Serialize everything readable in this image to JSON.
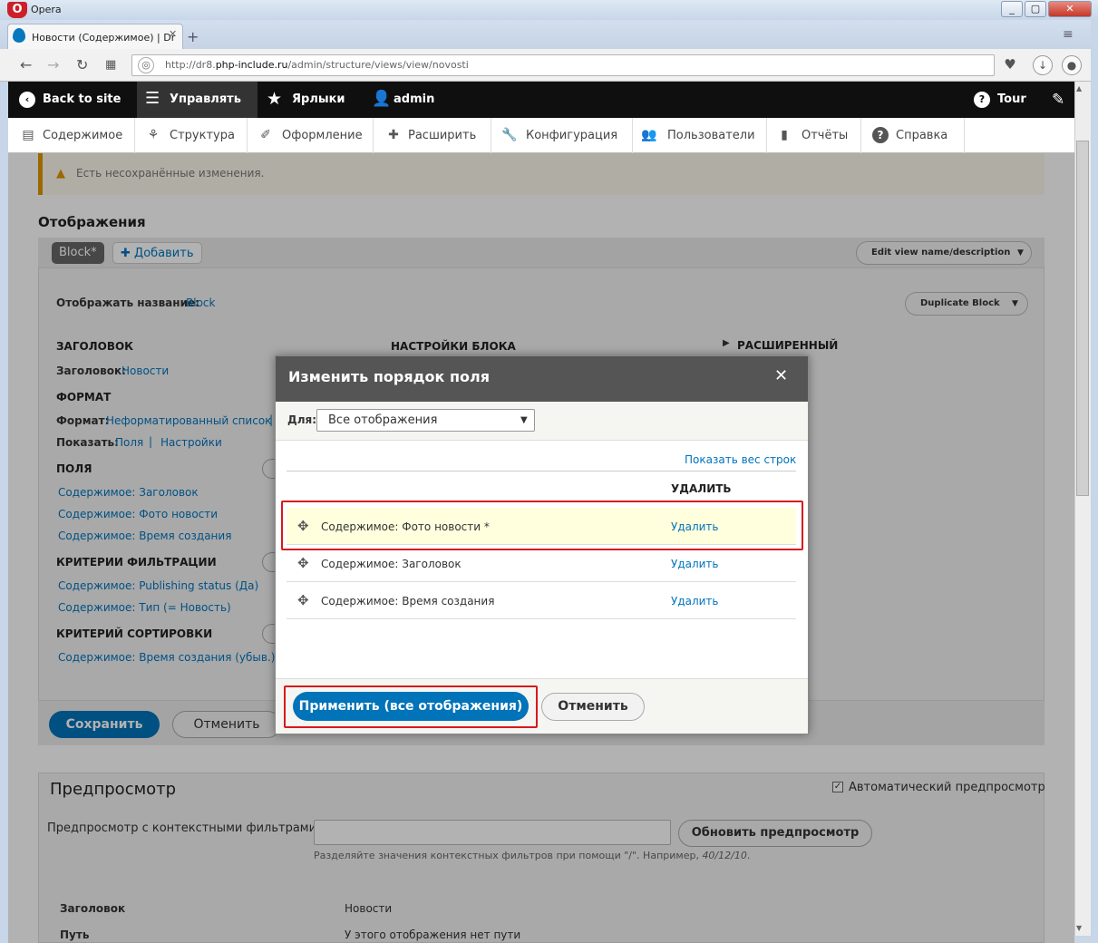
{
  "browser": {
    "app_name": "Opera",
    "tab_title": "Новости (Содержимое) | Dr",
    "url_prefix": "http://dr8.",
    "url_host": "php-include.ru",
    "url_path": "/admin/structure/views/view/novosti"
  },
  "toolbar": {
    "back": "Back to site",
    "manage": "Управлять",
    "shortcuts": "Ярлыки",
    "user": "admin",
    "tour": "Tour"
  },
  "tray": {
    "items": [
      "Содержимое",
      "Структура",
      "Оформление",
      "Расширить",
      "Конфигурация",
      "Пользователи",
      "Отчёты",
      "Справка"
    ]
  },
  "page": {
    "warning": "Есть несохранённые изменения.",
    "displays_title": "Отображения",
    "block_tab": "Block*",
    "add_tab": "Добавить",
    "edit_name_btn": "Edit view name/description",
    "duplicate_btn": "Duplicate Block",
    "display_name_label": "Отображать название:",
    "display_name_value": "Block",
    "col_title": "ЗАГОЛОВОК",
    "col_block_settings": "НАСТРОЙКИ БЛОКА",
    "col_advanced": "РАСШИРЕННЫЙ",
    "title_label": "Заголовок:",
    "title_value": "Новости",
    "format_h": "ФОРМАТ",
    "format_label": "Формат:",
    "format_value": "Неформатированный список",
    "show_label": "Показать:",
    "show_fields": "Поля",
    "show_settings": "Настройки",
    "fields_h": "ПОЛЯ",
    "fields": [
      "Содержимое: Заголовок",
      "Содержимое: Фото новости",
      "Содержимое: Время создания"
    ],
    "filters_h": "КРИТЕРИИ ФИЛЬТРАЦИИ",
    "filters": [
      "Содержимое: Publishing status (Да)",
      "Содержимое: Тип (= Новость)"
    ],
    "sort_h": "КРИТЕРИЙ СОРТИРОВКИ",
    "sorts": [
      "Содержимое: Время создания (убыв.)"
    ],
    "save_btn": "Сохранить",
    "cancel_btn": "Отменить",
    "preview_title": "Предпросмотр",
    "auto_preview": "Автоматический предпросмотр",
    "context_label": "Предпросмотр с контекстными фильтрами:",
    "update_preview_btn": "Обновить предпросмотр",
    "context_help": "Разделяйте значения контекстных фильтров при помощи \"/\". Например, ",
    "context_help_example": "40/12/10",
    "result_h1": "Заголовок",
    "result_v1": "Новости",
    "result_h2": "Путь",
    "result_v2": "У этого отображения нет пути"
  },
  "modal": {
    "title": "Изменить порядок поля",
    "for_label": "Для",
    "for_value": "Все отображения",
    "show_weights": "Показать вес строк",
    "col_delete": "УДАЛИТЬ",
    "rows": [
      {
        "label": "Содержимое: Фото новости *",
        "action": "Удалить"
      },
      {
        "label": "Содержимое: Заголовок",
        "action": "Удалить"
      },
      {
        "label": "Содержимое: Время создания",
        "action": "Удалить"
      }
    ],
    "apply_btn": "Применить (все отображения)",
    "cancel_btn": "Отменить"
  }
}
